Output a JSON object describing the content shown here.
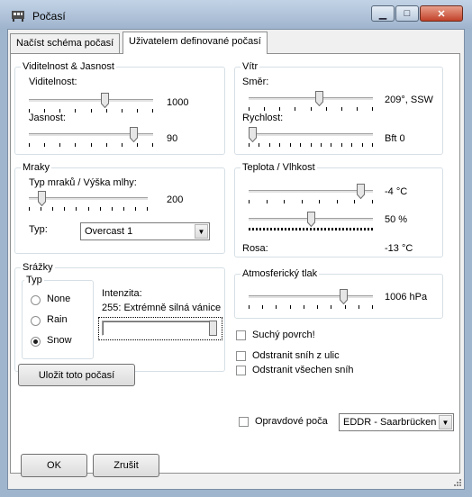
{
  "window": {
    "title": "Počasí",
    "minimize_symbol": "▁",
    "maximize_symbol": "□",
    "close_symbol": "✕",
    "icon": "weather-app-icon"
  },
  "tabs": [
    {
      "label": "Načíst schéma počasí",
      "active": false
    },
    {
      "label": "Uživatelem definované počasí",
      "active": true
    }
  ],
  "visibility": {
    "group_title": "Viditelnost & Jasnost",
    "visibility_label": "Viditelnost:",
    "visibility_value": "1000",
    "visibility_level": 0.62,
    "brightness_label": "Jasnost:",
    "brightness_value": "90",
    "brightness_level": 0.87
  },
  "wind": {
    "group_title": "Vítr",
    "direction_label": "Směr:",
    "direction_value": "209°, SSW",
    "direction_level": 0.57,
    "speed_label": "Rychlost:",
    "speed_value": "Bft 0",
    "speed_level": 0.0
  },
  "clouds": {
    "group_title": "Mraky",
    "type_height_label": "Typ mraků / Výška mlhy:",
    "type_height_value": "200",
    "type_height_level": 0.08,
    "type_label": "Typ:",
    "type_selected": "Overcast 1"
  },
  "temperature": {
    "group_title": "Teplota / Vlhkost",
    "temp_value": "-4 °C",
    "temp_level": 0.93,
    "humidity_value": "50 %",
    "humidity_level": 0.5,
    "dew_label": "Rosa:",
    "dew_value": "-13 °C"
  },
  "precipitation": {
    "group_title": "Srážky",
    "type_group_title": "Typ",
    "options": [
      {
        "label": "None",
        "selected": false
      },
      {
        "label": "Rain",
        "selected": false
      },
      {
        "label": "Snow",
        "selected": true
      }
    ],
    "intensity_label": "Intenzita:",
    "intensity_text": "255: Extrémně silná vánice",
    "intensity_level": 1.0
  },
  "pressure": {
    "group_title": "Atmosferický tlak",
    "value": "1006 hPa",
    "level": 0.78
  },
  "options": {
    "dry_surface": "Suchý povrch!",
    "remove_snow_roads": "Odstranit sníh z ulic",
    "remove_all_snow": "Odstranit všechen sníh",
    "real_weather": "Opravdové poča",
    "station_selected": "EDDR - Saarbrücken"
  },
  "buttons": {
    "save_weather": "Uložit toto počasí",
    "ok": "OK",
    "cancel": "Zrušit"
  },
  "colors": {
    "window_frame": "#9fb4cd",
    "close_button": "#c2412a"
  }
}
